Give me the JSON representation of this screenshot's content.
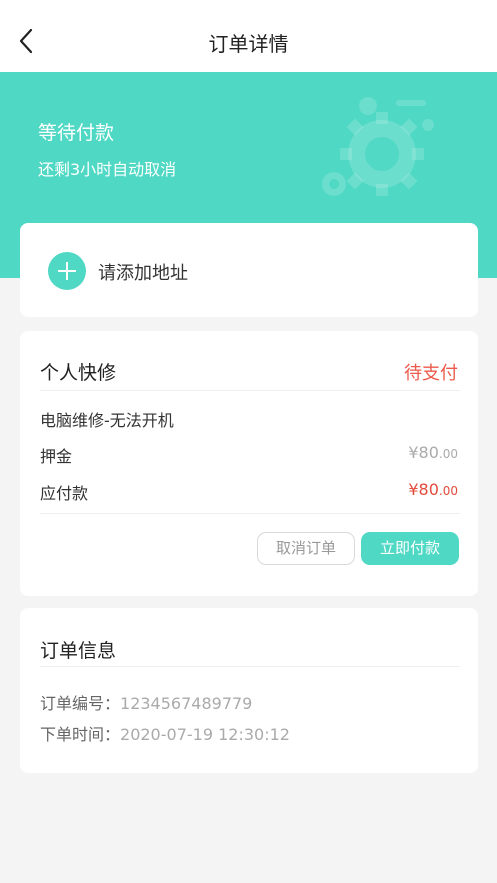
{
  "header": {
    "title": "订单详情",
    "back_icon": "back-chevron-icon"
  },
  "status": {
    "title": "等待付款",
    "subtitle": "还剩3小时自动取消",
    "decoration_icon": "gears-icon"
  },
  "address": {
    "label": "请添加地址",
    "icon": "plus-circle-icon"
  },
  "order": {
    "service_title": "个人快修",
    "pay_status": "待支付",
    "item_name": "电脑维修-无法开机",
    "deposit_label": "押金",
    "deposit_main": "¥80",
    "deposit_cents": ".00",
    "payable_label": "应付款",
    "payable_main": "¥80",
    "payable_cents": ".00",
    "cancel_label": "取消订单",
    "pay_label": "立即付款"
  },
  "info": {
    "title": "订单信息",
    "order_no_label": "订单编号：",
    "order_no": "1234567489779",
    "time_label": "下单时间：",
    "time": "2020-07-19 12:30:12"
  },
  "colors": {
    "accent": "#4fd8c4",
    "warn": "#ec5a4b",
    "price": "#e24b3b",
    "background": "#f4f4f4"
  }
}
